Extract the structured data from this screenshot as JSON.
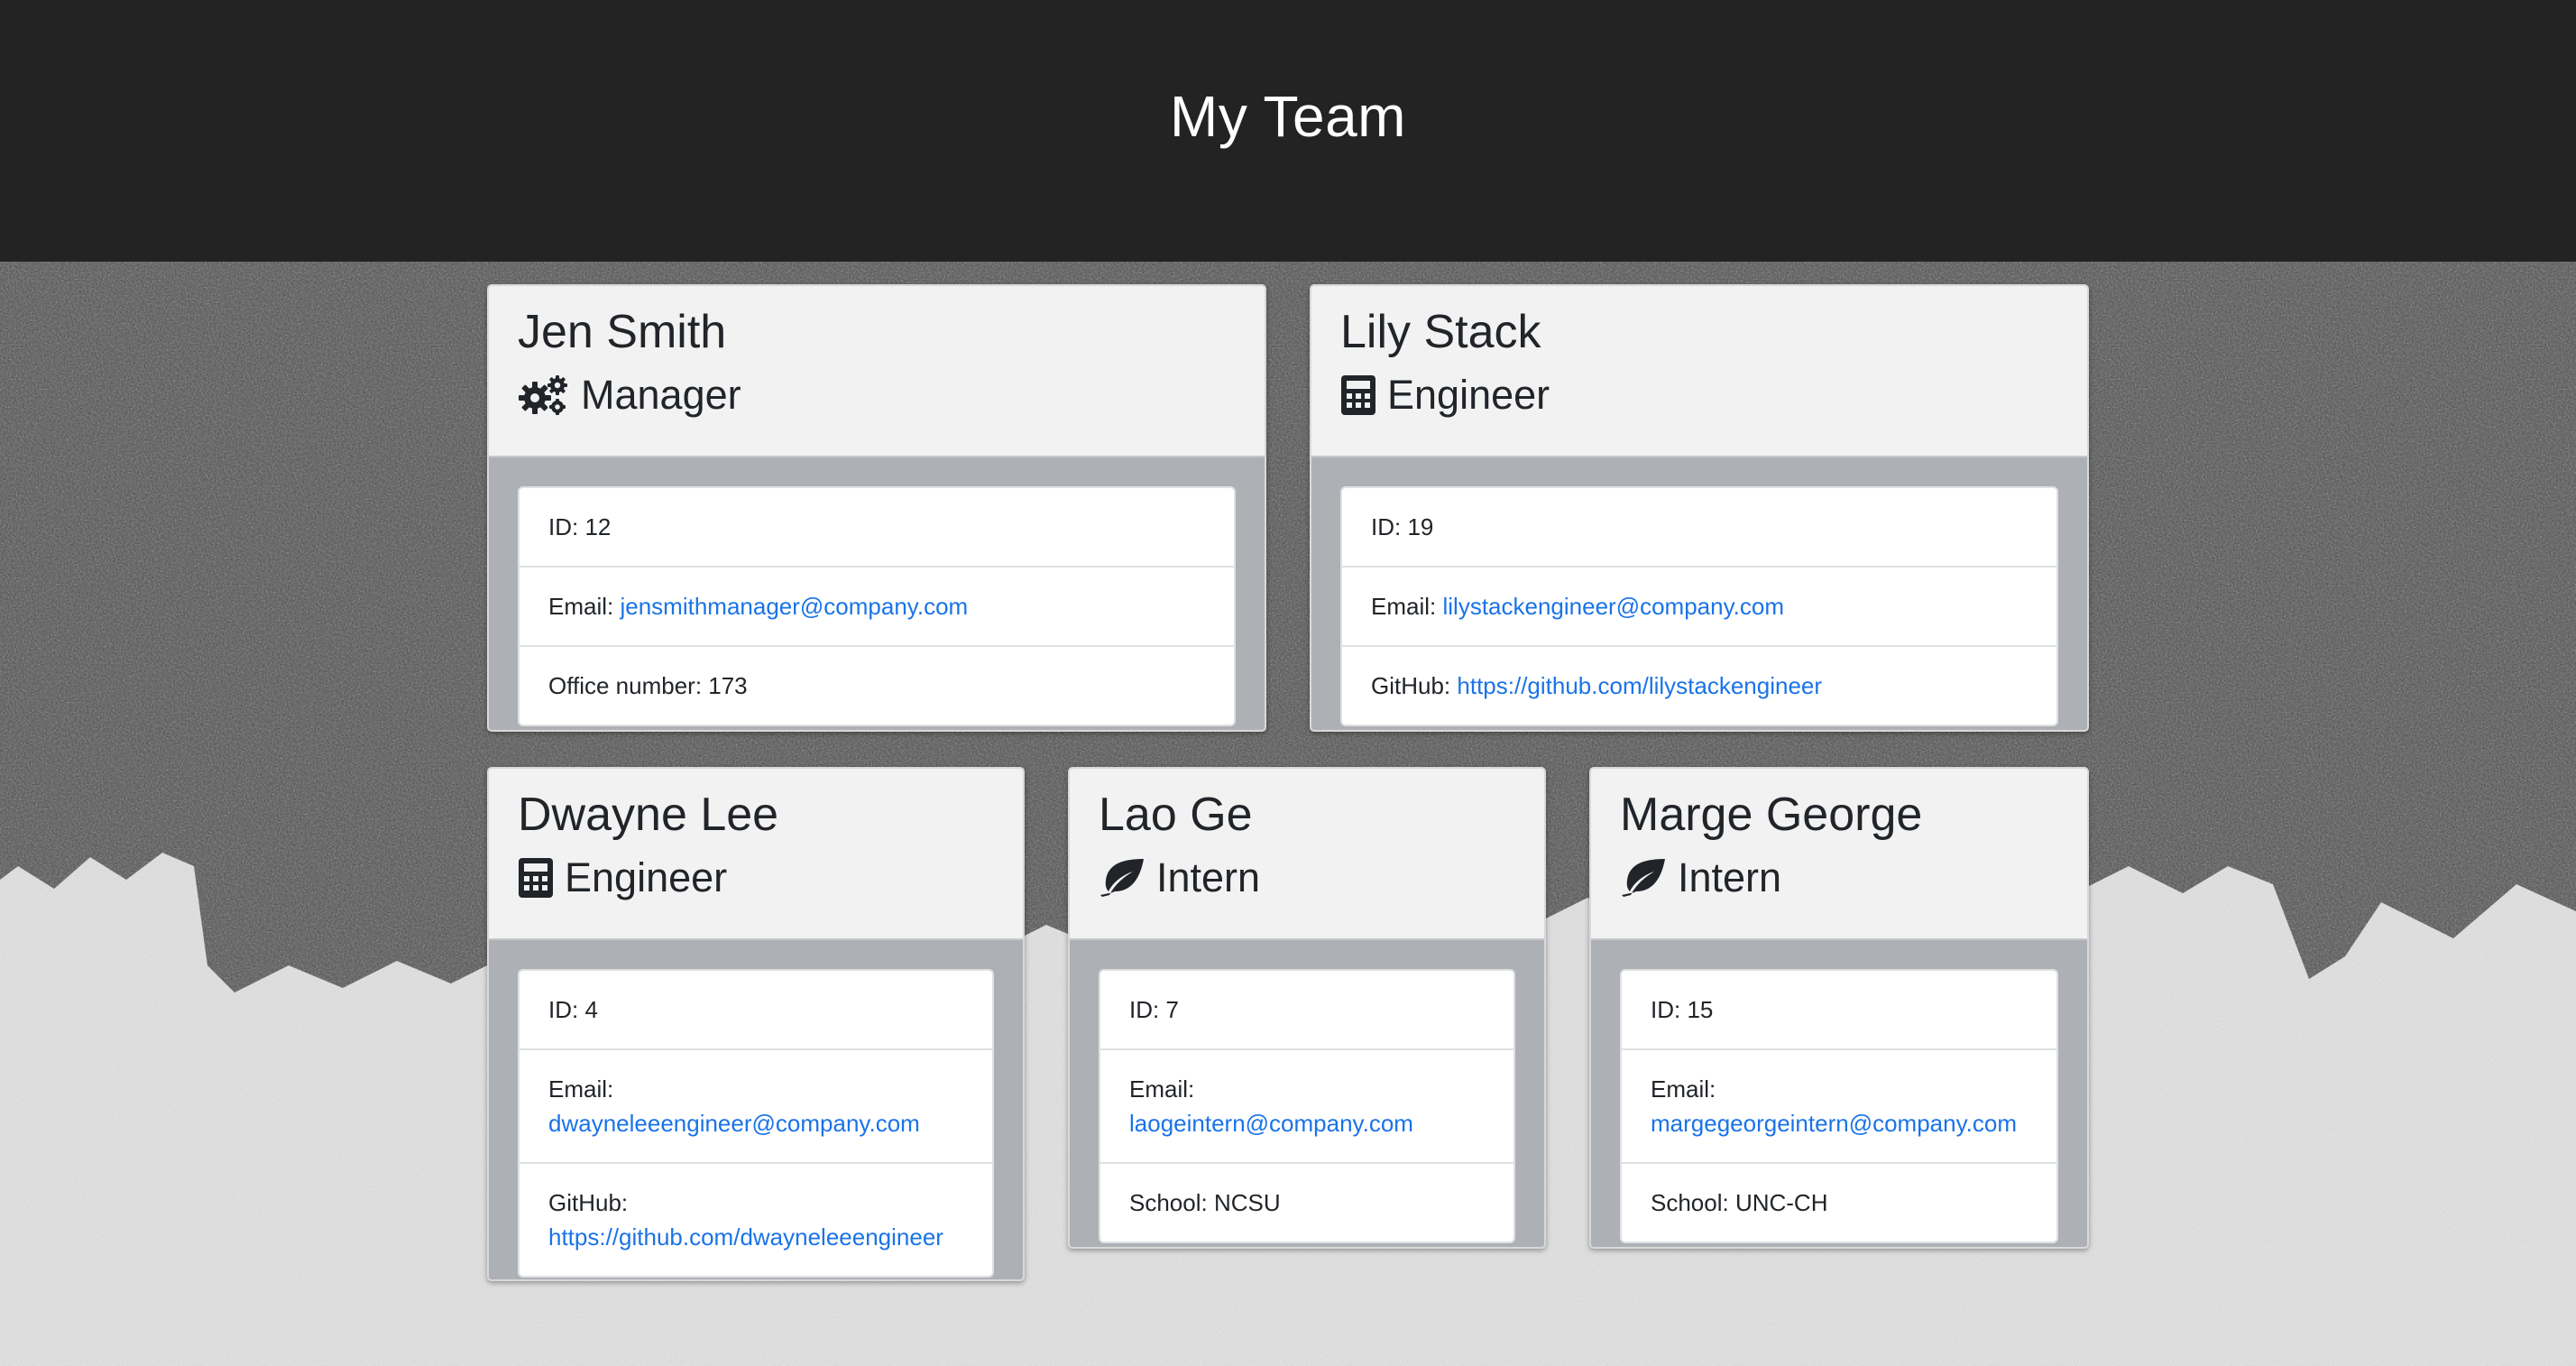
{
  "header": {
    "title": "My Team"
  },
  "team": [
    {
      "name": "Jen Smith",
      "role": "Manager",
      "icon": "gears-icon",
      "id_text": "ID: 12",
      "email_label": "Email:",
      "email": "jensmithmanager@company.com",
      "extra_label": "Office number: 173",
      "extra_value": ""
    },
    {
      "name": "Lily Stack",
      "role": "Engineer",
      "icon": "calculator-icon",
      "id_text": "ID: 19",
      "email_label": "Email:",
      "email": "lilystackengineer@company.com",
      "extra_label": "GitHub:",
      "extra_value": "https://github.com/lilystackengineer"
    },
    {
      "name": "Dwayne Lee",
      "role": "Engineer",
      "icon": "calculator-icon",
      "id_text": "ID: 4",
      "email_label": "Email:",
      "email": "dwayneleeengineer@company.com",
      "extra_label": "GitHub:",
      "extra_value": "https://github.com/dwayneleeengineer"
    },
    {
      "name": "Lao Ge",
      "role": "Intern",
      "icon": "leaf-icon",
      "id_text": "ID: 7",
      "email_label": "Email:",
      "email": "laogeintern@company.com",
      "extra_label": "School: NCSU",
      "extra_value": ""
    },
    {
      "name": "Marge George",
      "role": "Intern",
      "icon": "leaf-icon",
      "id_text": "ID: 15",
      "email_label": "Email:",
      "email": "margegeorgeintern@company.com",
      "extra_label": "School: UNC-CH",
      "extra_value": ""
    }
  ],
  "colors": {
    "header_bg": "#232323",
    "card_head_bg": "#f2f2f2",
    "card_body_bg": "#adb0b5",
    "link": "#1a73e8"
  }
}
